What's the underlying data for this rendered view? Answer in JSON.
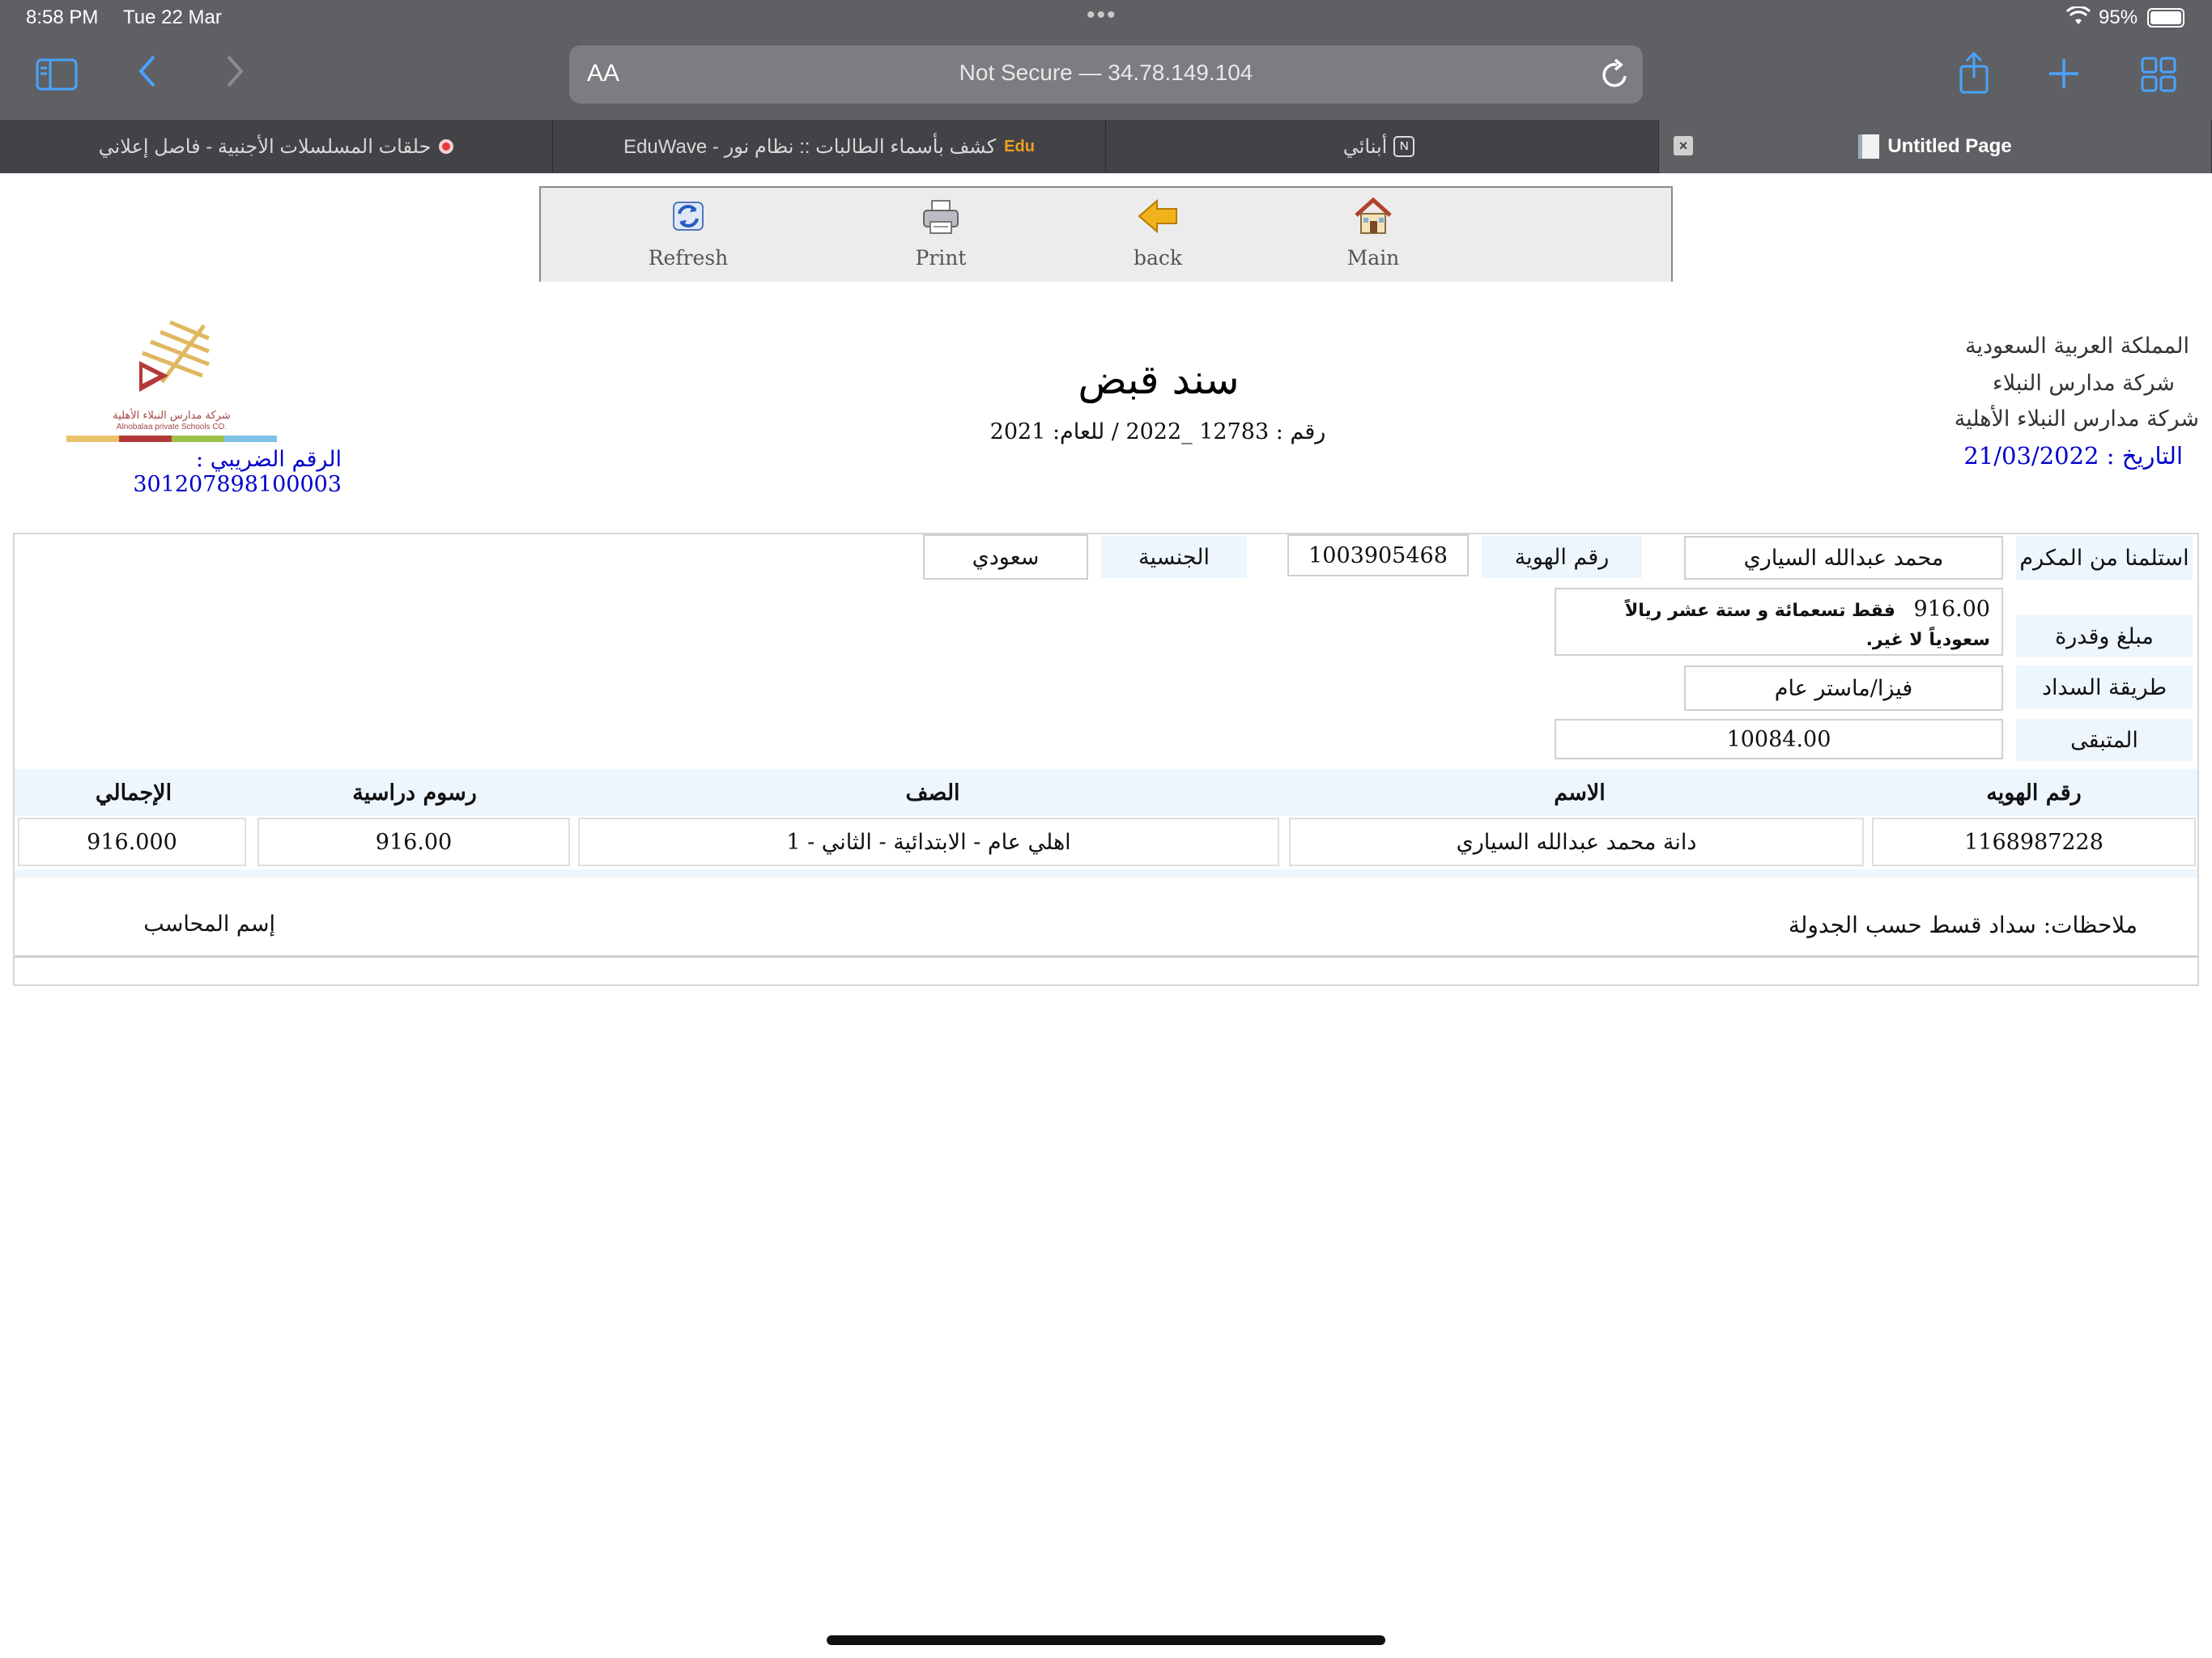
{
  "status_bar": {
    "time": "8:58 PM",
    "date": "Tue 22 Mar",
    "battery": "95%"
  },
  "browser": {
    "reader_btn": "AA",
    "url_text": "Not Secure — 34.78.149.104",
    "tabs": [
      {
        "label": "حلقات المسلسلات الأجنبية - فاصل إعلاني"
      },
      {
        "label": "كشف بأسماء الطالبات :: نظام نور - EduWave"
      },
      {
        "label": "أبنائي"
      },
      {
        "label": "Untitled Page"
      }
    ]
  },
  "toolbar": {
    "refresh": "Refresh",
    "print": "Print",
    "back": "back",
    "main": "Main"
  },
  "header": {
    "country": "المملكة العربية السعودية",
    "company_short": "شركة مدارس النبلاء",
    "company_full": "شركة مدارس النبلاء الأهلية",
    "date_line": "التاريخ : 21/03/2022",
    "title": "سند قبض",
    "number_line": "رقم : 12783 _2022 / للعام: 2021",
    "tax_line": "الرقم الضريبي : 301207898100003",
    "logo_ar": "شركة مدارس النبلاء الأهلية",
    "logo_en": "Alnobalaa private Schools CO."
  },
  "form": {
    "received_from_label": "استلمنا من المكرم",
    "received_from_value": "محمد عبدالله السياري",
    "id_label": "رقم الهوية",
    "id_value": "1003905468",
    "nationality_label": "الجنسية",
    "nationality_value": "سعودي",
    "amount_label": "مبلغ وقدرة",
    "amount_value": "916.00",
    "amount_words": "فقط تسعمائة و ستة عشر ريالاً سعودياً لا غير.",
    "payment_label": "طريقة السداد",
    "payment_value": "فيزا/ماستر عام",
    "remaining_label": "المتبقى",
    "remaining_value": "10084.00"
  },
  "table": {
    "headers": [
      "رقم الهويه",
      "الاسم",
      "الصف",
      "رسوم دراسية",
      "الإجمالي"
    ],
    "rows": [
      [
        "1168987228",
        "دانة محمد عبدالله السياري",
        "اهلي عام - الابتدائية - الثاني - 1",
        "916.00",
        "916.000"
      ]
    ]
  },
  "footer": {
    "notes": "ملاحظات: سداد قسط حسب الجدولة",
    "accountant": "إسم المحاسب"
  }
}
